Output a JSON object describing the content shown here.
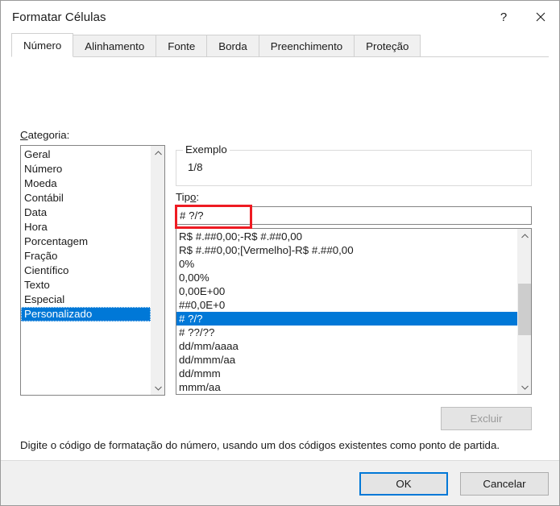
{
  "window": {
    "title": "Formatar Células",
    "help_icon": "question-mark-icon",
    "close_icon": "close-icon"
  },
  "tabs": [
    {
      "label": "Número",
      "active": true
    },
    {
      "label": "Alinhamento",
      "active": false
    },
    {
      "label": "Fonte",
      "active": false
    },
    {
      "label": "Borda",
      "active": false
    },
    {
      "label": "Preenchimento",
      "active": false
    },
    {
      "label": "Proteção",
      "active": false
    }
  ],
  "category": {
    "label": "Categoria:",
    "accesskey": "C",
    "selected": "Personalizado",
    "items": [
      "Geral",
      "Número",
      "Moeda",
      "Contábil",
      "Data",
      "Hora",
      "Porcentagem",
      "Fração",
      "Científico",
      "Texto",
      "Especial",
      "Personalizado"
    ]
  },
  "example": {
    "legend": "Exemplo",
    "value": "1/8"
  },
  "type": {
    "label_pre": "Tip",
    "label_accesskey": "o",
    "label_post": ":",
    "value": "# ?/?",
    "selected": "# ?/?",
    "highlight_color": "#ee1b22",
    "items": [
      "R$ #.##0,00;-R$ #.##0,00",
      "R$ #.##0,00;[Vermelho]-R$ #.##0,00",
      "0%",
      "0,00%",
      "0,00E+00",
      "##0,0E+0",
      "# ?/?",
      "# ??/??",
      "dd/mm/aaaa",
      "dd/mmm/aa",
      "dd/mmm",
      "mmm/aa"
    ]
  },
  "delete_button": {
    "label": "Excluir",
    "enabled": false
  },
  "help_text": "Digite o código de formatação do número, usando um dos códigos existentes como ponto de partida.",
  "footer": {
    "ok_label": "OK",
    "cancel_label": "Cancelar",
    "focus_color": "#0078d7"
  },
  "colors": {
    "selection": "#0078d7",
    "dialog_bg": "#ffffff",
    "footer_bg": "#f0f0f0"
  }
}
